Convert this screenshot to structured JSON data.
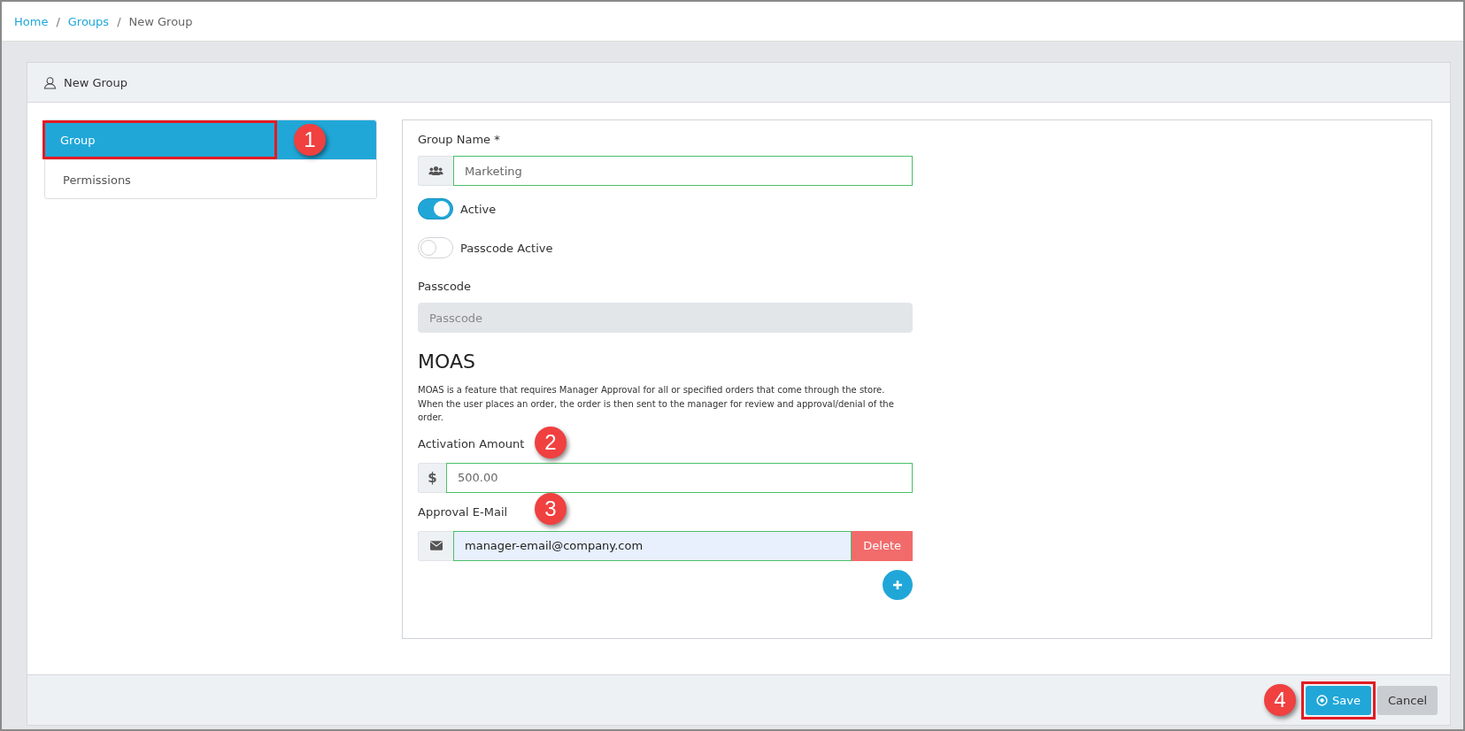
{
  "breadcrumb": {
    "separator": "/",
    "items": [
      {
        "label": "Home",
        "link": true
      },
      {
        "label": "Groups",
        "link": true
      },
      {
        "label": "New Group",
        "link": false
      }
    ]
  },
  "card": {
    "title": "New Group"
  },
  "nav": [
    {
      "label": "Group",
      "selected": true,
      "highlighted": true,
      "callout": "1"
    },
    {
      "label": "Permissions",
      "selected": false,
      "highlighted": false
    }
  ],
  "form": {
    "group_name": {
      "label": "Group Name *",
      "value": "Marketing"
    },
    "toggles": [
      {
        "label": "Active",
        "on": true
      },
      {
        "label": "Passcode Active",
        "on": false
      }
    ],
    "passcode": {
      "label": "Passcode",
      "placeholder": "Passcode",
      "disabled": true
    },
    "moas": {
      "heading": "MOAS",
      "description": "MOAS is a feature that requires Manager Approval for all or specified orders that come through the store. When the user places an order, the order is then sent to the manager for review and approval/denial of the order."
    },
    "activation_amount": {
      "label": "Activation Amount",
      "prefix": "$",
      "value": "500.00",
      "callout": "2"
    },
    "approval_email": {
      "label": "Approval E-Mail",
      "value": "manager-email@company.com",
      "delete_label": "Delete",
      "callout": "3"
    }
  },
  "footer": {
    "buttons": [
      {
        "label": "Save",
        "kind": "primary",
        "highlighted": true,
        "callout": "4"
      },
      {
        "label": "Cancel",
        "kind": "secondary",
        "highlighted": false
      }
    ]
  }
}
